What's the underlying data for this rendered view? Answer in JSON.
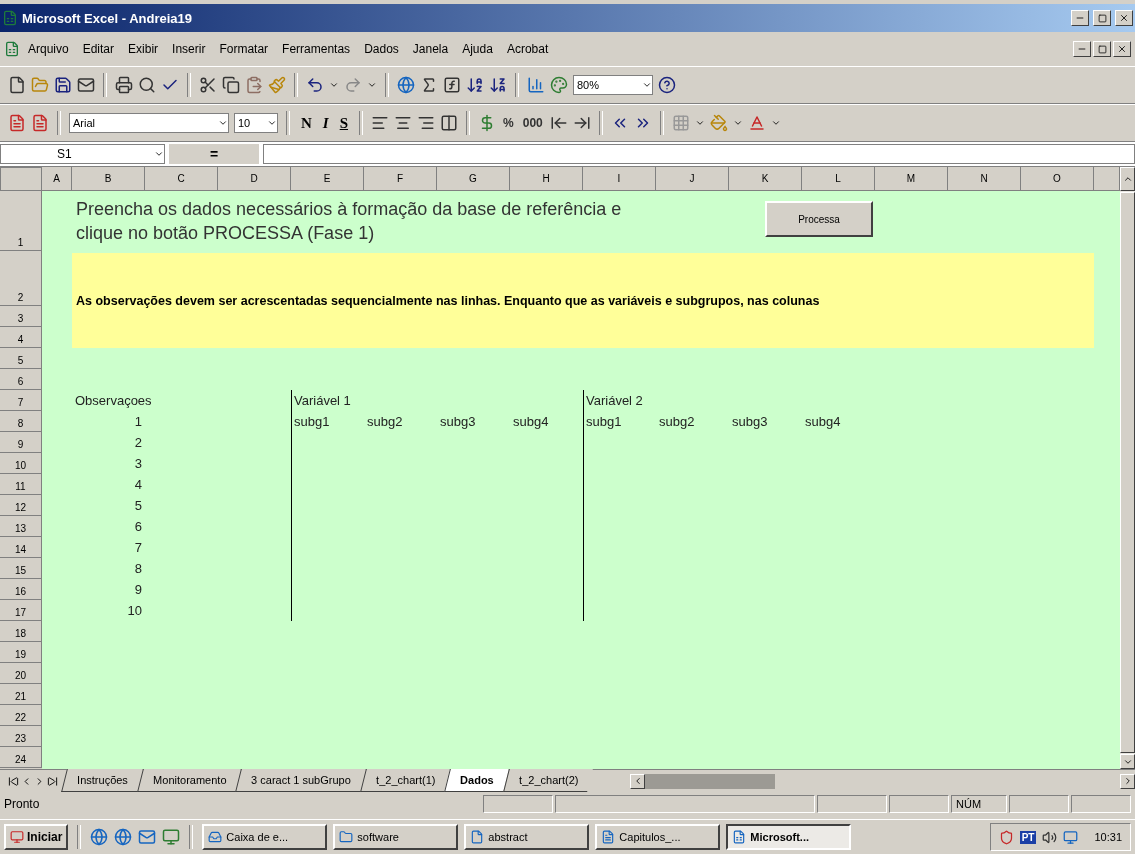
{
  "window": {
    "title": "Microsoft Excel - Andreia19"
  },
  "menu": [
    "Arquivo",
    "Editar",
    "Exibir",
    "Inserir",
    "Formatar",
    "Ferramentas",
    "Dados",
    "Janela",
    "Ajuda",
    "Acrobat"
  ],
  "standard_toolbar": {
    "zoom": "80%"
  },
  "formatting_toolbar": {
    "font": "Arial",
    "font_size": "10",
    "style_buttons": [
      "N",
      "I",
      "S"
    ],
    "number_buttons": [
      "%",
      "000"
    ]
  },
  "formula_bar": {
    "name_box": "S1",
    "equals": "="
  },
  "sheet": {
    "columns": [
      "A",
      "B",
      "C",
      "D",
      "E",
      "F",
      "G",
      "H",
      "I",
      "J",
      "K",
      "L",
      "M",
      "N",
      "O"
    ],
    "rows": [
      "1",
      "2",
      "3",
      "4",
      "5",
      "6",
      "7",
      "8",
      "9",
      "10",
      "11",
      "12",
      "13",
      "14",
      "15",
      "16",
      "17",
      "18",
      "19",
      "20",
      "21",
      "22",
      "23",
      "24"
    ],
    "instruction_lines": [
      "Preencha os dados necessários à formação da base de referência e",
      "clique no botão PROCESSA (Fase 1)"
    ],
    "process_button": "Processa",
    "note": "As observações devem ser acrescentadas sequencialmente nas linhas. Enquanto que as variáveis e subgrupos, nas colunas",
    "observations_header": "Observaçoes",
    "observations": [
      "1",
      "2",
      "3",
      "4",
      "5",
      "6",
      "7",
      "8",
      "9",
      "10"
    ],
    "variables": [
      {
        "name": "Variável 1",
        "subgroups": [
          "subg1",
          "subg2",
          "subg3",
          "subg4"
        ]
      },
      {
        "name": "Variável 2",
        "subgroups": [
          "subg1",
          "subg2",
          "subg3",
          "subg4"
        ]
      }
    ]
  },
  "sheet_tabs": [
    {
      "label": "Instruções",
      "selected": false
    },
    {
      "label": "Monitoramento",
      "selected": false
    },
    {
      "label": "3 caract 1 subGrupo",
      "selected": false
    },
    {
      "label": "t_2_chart(1)",
      "selected": false
    },
    {
      "label": "Dados",
      "selected": true
    },
    {
      "label": "t_2_chart(2)",
      "selected": false
    }
  ],
  "status_bar": {
    "status": "Pronto",
    "indicators": [
      "NÚM"
    ]
  },
  "taskbar": {
    "start": "Iniciar",
    "tasks": [
      {
        "label": "Caixa de e...",
        "selected": false
      },
      {
        "label": "software",
        "selected": false
      },
      {
        "label": "abstract",
        "selected": false
      },
      {
        "label": "Capitulos_...",
        "selected": false
      },
      {
        "label": "Microsoft...",
        "selected": true
      }
    ],
    "language": "PT",
    "clock": "10:31"
  }
}
